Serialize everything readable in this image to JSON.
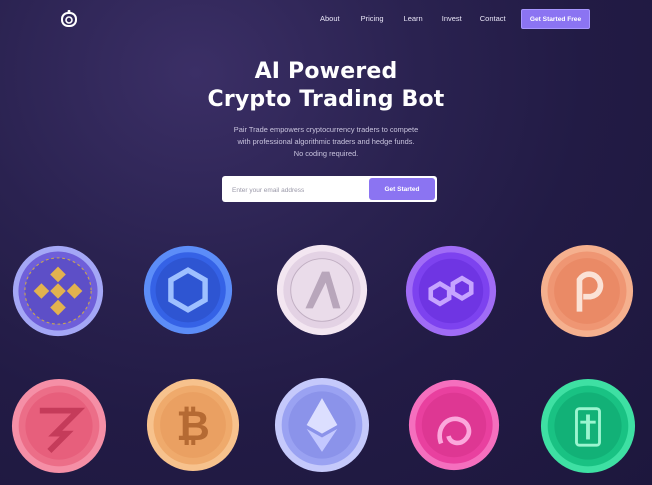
{
  "nav": {
    "logo_icon": "ring-logo-icon",
    "links": [
      "About",
      "Pricing",
      "Learn",
      "Invest",
      "Contact"
    ],
    "cta_label": "Get Started Free"
  },
  "hero": {
    "title_line1": "AI Powered",
    "title_line2": "Crypto Trading Bot",
    "subtitle_line1": "Pair Trade empowers cryptocurrency traders to compete",
    "subtitle_line2": "with professional algorithmic traders and hedge funds.",
    "subtitle_line3": "No coding required."
  },
  "signup": {
    "placeholder": "Enter your email address",
    "button_label": "Get Started"
  },
  "coins": [
    {
      "name": "binance-coin-icon",
      "color": "#7d6de8"
    },
    {
      "name": "chainlink-coin-icon",
      "color": "#3f6ff2"
    },
    {
      "name": "algorand-coin-icon",
      "color": "#e8d8ec"
    },
    {
      "name": "polygon-coin-icon",
      "color": "#8a52f5"
    },
    {
      "name": "polkadot-coin-icon",
      "color": "#f09a78"
    },
    {
      "name": "chainflip-coin-icon",
      "color": "#f07a93"
    },
    {
      "name": "bitcoin-coin-icon",
      "color": "#f1b27a"
    },
    {
      "name": "ethereum-coin-icon",
      "color": "#9ea4f3"
    },
    {
      "name": "uniswap-coin-icon",
      "color": "#ef4fae"
    },
    {
      "name": "tether-coin-icon",
      "color": "#2bc78d"
    }
  ]
}
